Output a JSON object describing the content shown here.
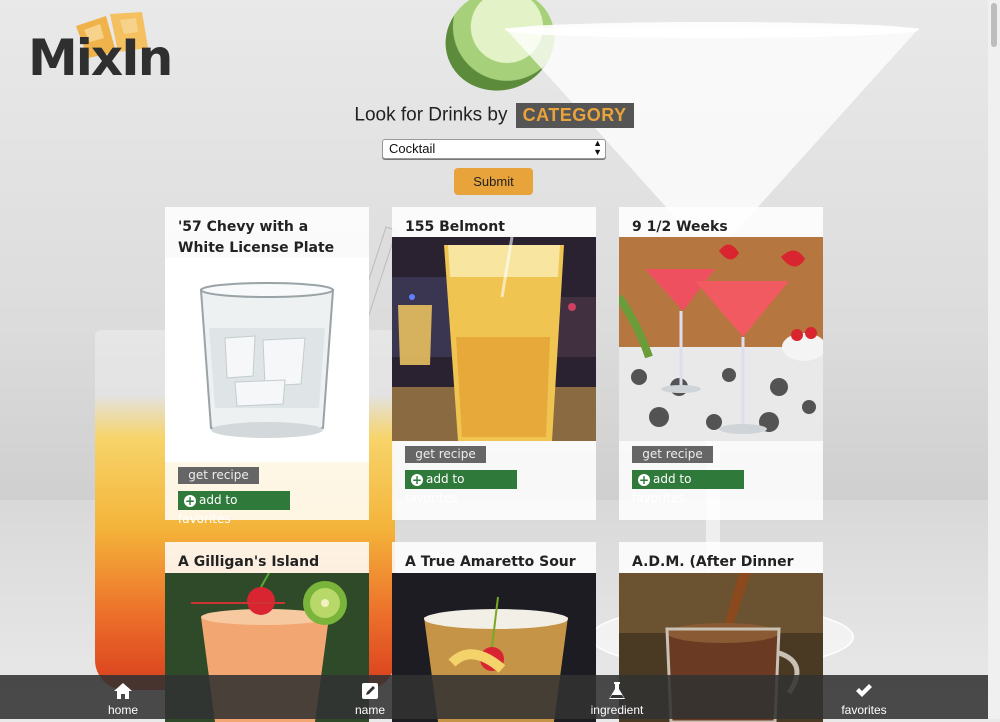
{
  "logo": {
    "text_main": "MixIn"
  },
  "heading": {
    "prefix": "Look for Drinks by",
    "category_badge": "CATEGORY"
  },
  "category_select": {
    "selected": "Cocktail"
  },
  "submit_label": "Submit",
  "card_buttons": {
    "recipe": "get recipe",
    "favorite": "add to favorites"
  },
  "drinks": [
    {
      "name": "'57 Chevy with a White License Plate"
    },
    {
      "name": "155 Belmont"
    },
    {
      "name": "9 1/2 Weeks"
    },
    {
      "name": "A Gilligan's Island"
    },
    {
      "name": "A True Amaretto Sour"
    },
    {
      "name": "A.D.M. (After Dinner Mint)"
    }
  ],
  "tabbar": [
    {
      "label": "home",
      "icon": "home-icon"
    },
    {
      "label": "name",
      "icon": "edit-icon"
    },
    {
      "label": "ingredient",
      "icon": "flask-icon"
    },
    {
      "label": "favorites",
      "icon": "check-icon"
    }
  ],
  "colors": {
    "accent": "#e9a33b",
    "favorite_green": "#2f7a3a",
    "tabbar": "#323232"
  }
}
